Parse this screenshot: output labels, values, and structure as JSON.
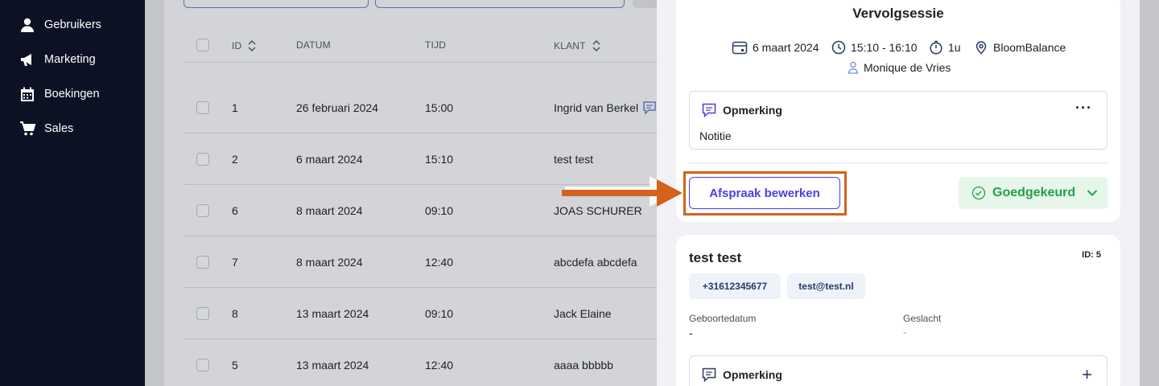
{
  "sidebar": {
    "items": [
      {
        "label": "Gebruikers",
        "icon": "user-icon"
      },
      {
        "label": "Marketing",
        "icon": "megaphone-icon"
      },
      {
        "label": "Boekingen",
        "icon": "calendar-icon"
      },
      {
        "label": "Sales",
        "icon": "cart-icon"
      }
    ]
  },
  "table": {
    "headers": {
      "id": "ID",
      "date": "DATUM",
      "time": "TIJD",
      "client": "KLANT"
    },
    "rows": [
      {
        "id": "1",
        "date": "26 februari 2024",
        "time": "15:00",
        "client": "Ingrid van Berkel"
      },
      {
        "id": "2",
        "date": "6 maart 2024",
        "time": "15:10",
        "client": "test test"
      },
      {
        "id": "6",
        "date": "8 maart 2024",
        "time": "09:10",
        "client": "JOAS SCHURER"
      },
      {
        "id": "7",
        "date": "8 maart 2024",
        "time": "12:40",
        "client": "abcdefa abcdefa"
      },
      {
        "id": "8",
        "date": "13 maart 2024",
        "time": "09:10",
        "client": "Jack Elaine"
      },
      {
        "id": "5",
        "date": "13 maart 2024",
        "time": "12:40",
        "client": "aaaa bbbbb"
      }
    ]
  },
  "appointment": {
    "title": "Vervolgsessie",
    "date": "6 maart 2024",
    "time": "15:10 - 16:10",
    "duration": "1u",
    "location": "BloomBalance",
    "staff": "Monique de Vries",
    "note_title": "Opmerking",
    "note_text": "Notitie",
    "edit_label": "Afspraak bewerken",
    "status_label": "Goedgekeurd"
  },
  "client": {
    "name": "test test",
    "id_label": "ID: 5",
    "phone": "+31612345677",
    "email": "test@test.nl",
    "birthdate_label": "Geboortedatum",
    "birthdate_value": "-",
    "gender_label": "Geslacht",
    "gender_value": "-",
    "note_title": "Opmerking"
  },
  "colors": {
    "sidebar_bg": "#0d1124",
    "accent": "#4b3fe0",
    "success": "#22a14a",
    "highlight": "#d3621b"
  }
}
